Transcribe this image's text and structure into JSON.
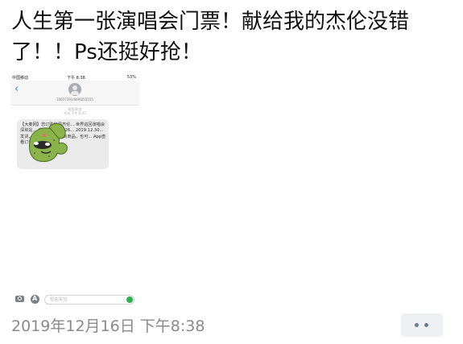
{
  "post": {
    "text": "人生第一张演唱会门票！献给我的杰伦没错了！！Ps还挺好抢！"
  },
  "screenshot": {
    "status": {
      "carrier": "中国移动",
      "time": "下午 8:38",
      "battery": "53%"
    },
    "sender": "106573914499255555",
    "date_line1": "短信/彩信",
    "date_line2": "今天 下午 8:35",
    "sms_text": "【大麦网】您订购的周杰伦... 世界巡回演唱会深圳站... 手机... 3381726... 2019.12.30... 发货，您可在发... 内收到商品，也可... App查看订单详情",
    "input_placeholder": "短信/彩信"
  },
  "footer": {
    "timestamp": "2019年12月16日 下午8:38",
    "more": "••"
  },
  "colors": {
    "accent_blue": "#2f7ef5",
    "timestamp_gray": "#8a8a8a",
    "more_button_bg": "#eef0f3",
    "more_dots": "#6e7a94",
    "sticker_green": "#8ab34a"
  },
  "icons": [
    "back-icon",
    "avatar-icon",
    "camera-icon",
    "appstore-icon",
    "mic-icon",
    "more-icon"
  ]
}
